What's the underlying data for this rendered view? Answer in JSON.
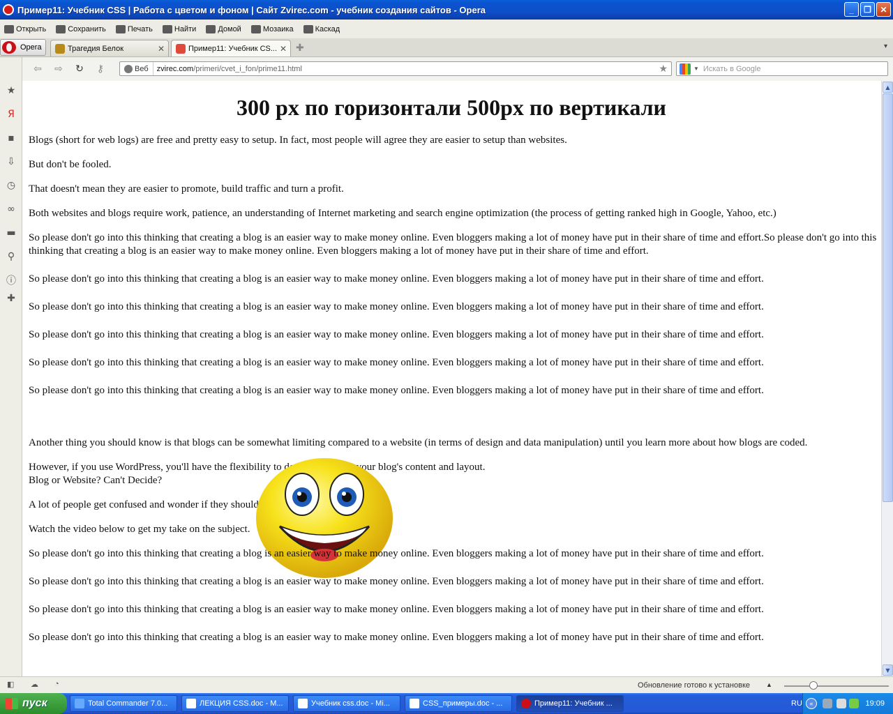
{
  "window": {
    "title": "Пример11: Учебник CSS | Работа с цветом и фоном | Сайт Zvirec.com - учебник создания сайтов - Opera",
    "btn_min": "_",
    "btn_max": "❐",
    "btn_close": "✕"
  },
  "toolbar": {
    "items": [
      {
        "label": "Открыть",
        "icon": "folder-open-icon"
      },
      {
        "label": "Сохранить",
        "icon": "save-icon"
      },
      {
        "label": "Печать",
        "icon": "printer-icon"
      },
      {
        "label": "Найти",
        "icon": "find-icon"
      },
      {
        "label": "Домой",
        "icon": "home-icon"
      },
      {
        "label": "Мозаика",
        "icon": "tile-icon"
      },
      {
        "label": "Каскад",
        "icon": "cascade-icon"
      }
    ]
  },
  "tabs": {
    "opera_menu": "Opera",
    "items": [
      {
        "label": "Трагедия Белок",
        "active": false
      },
      {
        "label": "Пример11: Учебник CS...",
        "active": true
      }
    ],
    "close_glyph": "✕",
    "new_tab_glyph": "✚",
    "menu_glyph": "▾"
  },
  "addressbar": {
    "chip_label": "Веб",
    "url_host": "zvirec.com",
    "url_path": "/primeri/cvet_i_fon/prime11.html",
    "search_placeholder": "Искать в Google"
  },
  "page": {
    "heading": "300 px по горизонтали 500px по вертикали",
    "paragraphs": [
      "Blogs (short for web logs) are free and pretty easy to setup. In fact, most people will agree they are easier to setup than websites.",
      "But don't be fooled.",
      "That doesn't mean they are easier to promote, build traffic and turn a profit.",
      "Both websites and blogs require work, patience, an understanding of Internet marketing and search engine optimization (the process of getting ranked high in Google, Yahoo, etc.)",
      "So please don't go into this thinking that creating a blog is an easier way to make money online. Even bloggers making a lot of money have put in their share of time and effort.So please don't go into this thinking that creating a blog is an easier way to make money online. Even bloggers making a lot of money have put in their share of time and effort.",
      "So please don't go into this thinking that creating a blog is an easier way to make money online. Even bloggers making a lot of money have put in their share of time and effort.",
      "So please don't go into this thinking that creating a blog is an easier way to make money online. Even bloggers making a lot of money have put in their share of time and effort.",
      "So please don't go into this thinking that creating a blog is an easier way to make money online. Even bloggers making a lot of money have put in their share of time and effort.",
      "So please don't go into this thinking that creating a blog is an easier way to make money online. Even bloggers making a lot of money have put in their share of time and effort.",
      "So please don't go into this thinking that creating a blog is an easier way to make money online. Even bloggers making a lot of money have put in their share of time and effort.",
      "Another thing you should know is that blogs can be somewhat limiting compared to a website (in terms of design and data manipulation) until you learn more about how blogs are coded.",
      "However, if you use WordPress, you'll have the flexibility to do so much with your blog's content and layout.",
      "Blog or Website? Can't Decide?",
      "A lot of people get confused and wonder if they should create a blog, website or both?",
      "Watch the video below to get my take on the subject.",
      "So please don't go into this thinking that creating a blog is an easier way to make money online. Even bloggers making a lot of money have put in their share of time and effort.",
      "So please don't go into this thinking that creating a blog is an easier way to make money online. Even bloggers making a lot of money have put in their share of time and effort.",
      "So please don't go into this thinking that creating a blog is an easier way to make money online. Even bloggers making a lot of money have put in their share of time and effort.",
      "So please don't go into this thinking that creating a blog is an easier way to make money online. Even bloggers making a lot of money have put in their share of time and effort."
    ]
  },
  "statusbar": {
    "message": "Обновление готово к установке"
  },
  "taskbar": {
    "start_label": "пуск",
    "tasks": [
      {
        "label": "Total Commander 7.0...",
        "active": false
      },
      {
        "label": "ЛЕКЦИЯ CSS.doc - M...",
        "active": false
      },
      {
        "label": "Учебник css.doc - Mi...",
        "active": false
      },
      {
        "label": "CSS_примеры.doc - ...",
        "active": false
      },
      {
        "label": "Пример11: Учебник ...",
        "active": true
      }
    ],
    "lang": "RU",
    "clock": "19:09"
  },
  "colors": {
    "titlebar": "#0a53cf",
    "taskbar": "#245edb",
    "start": "#3a9a3a",
    "opera_red": "#cc0f16",
    "smiley_yellow": "#f7e21a"
  }
}
